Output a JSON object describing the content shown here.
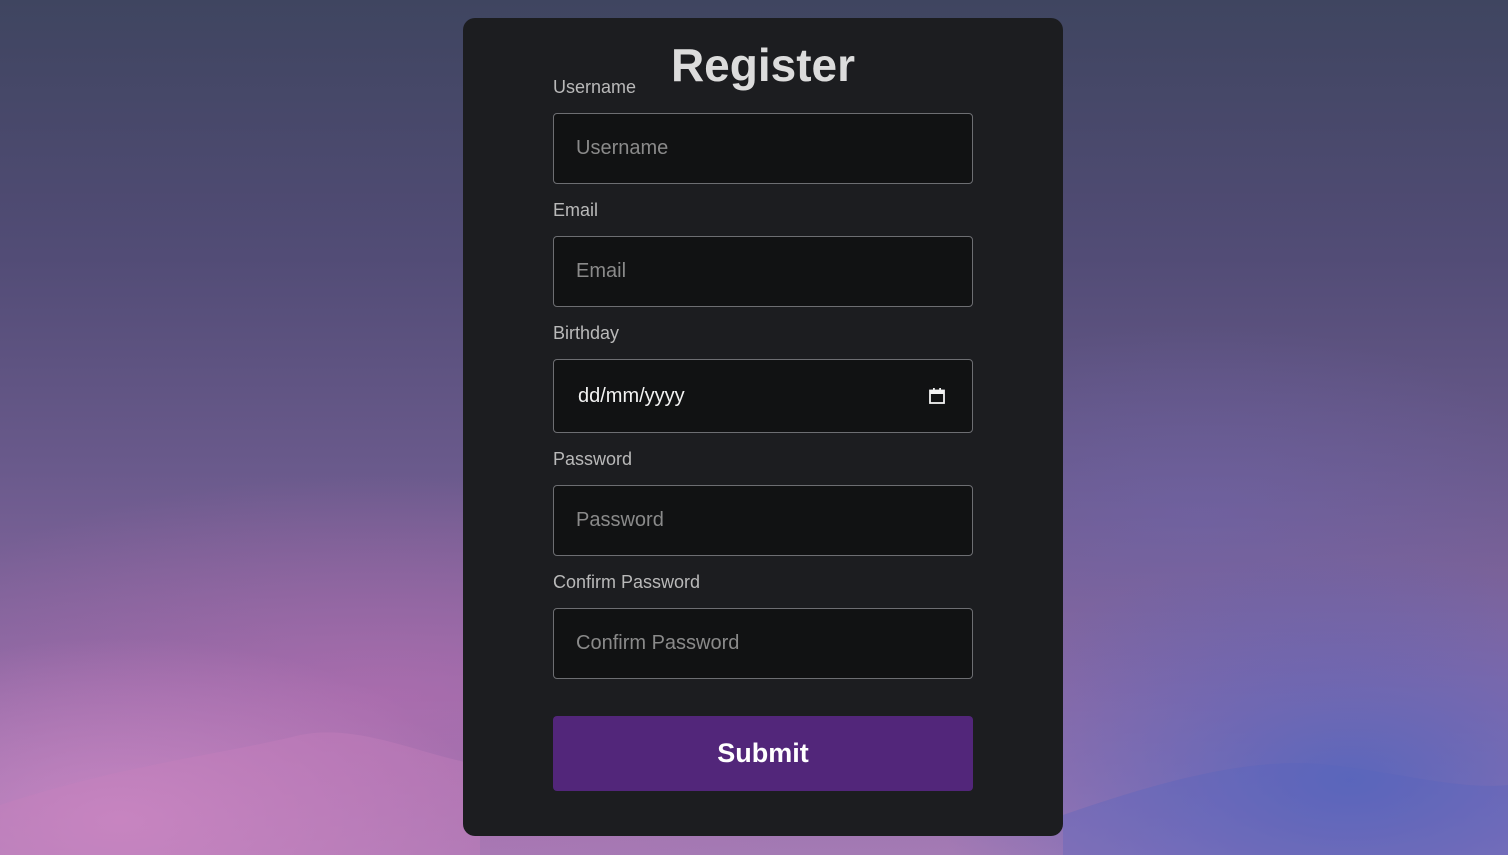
{
  "form": {
    "title": "Register",
    "fields": {
      "username": {
        "label": "Username",
        "placeholder": "Username"
      },
      "email": {
        "label": "Email",
        "placeholder": "Email"
      },
      "birthday": {
        "label": "Birthday",
        "value_format": "dd/mm/yyyy",
        "icon": "calendar-icon"
      },
      "password": {
        "label": "Password",
        "placeholder": "Password"
      },
      "confirm_password": {
        "label": "Confirm Password",
        "placeholder": "Confirm Password"
      }
    },
    "submit_label": "Submit"
  },
  "colors": {
    "card_background": "#1c1d20",
    "input_background": "#111213",
    "input_border": "#6d6e72",
    "submit_background": "#52267a",
    "title_text": "#dcdcdc",
    "label_text": "#b9b9b9"
  }
}
